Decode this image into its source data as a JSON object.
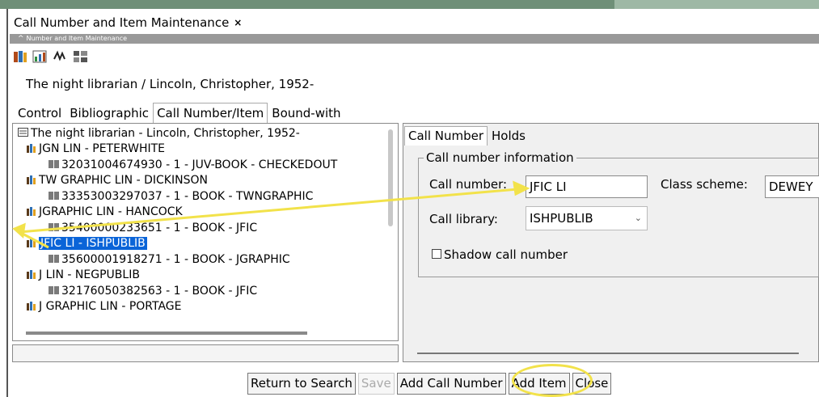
{
  "tab": {
    "title": "Call Number and Item Maintenance",
    "close": "×"
  },
  "window": {
    "subtitle": "Number and Item Maintenance"
  },
  "toolbar": {
    "icons": [
      "book-icon",
      "chart-icon",
      "sign-icon",
      "grid-icon"
    ]
  },
  "record": {
    "title_line": "The night librarian / Lincoln, Christopher, 1952-"
  },
  "main_tabs": [
    "Control",
    "Bibliographic",
    "Call Number/Item",
    "Bound-with"
  ],
  "tree": {
    "root": "The night librarian - Lincoln, Christopher, 1952-",
    "nodes": [
      "JGN LIN - PETERWHITE",
      "32031004674930 - 1 - JUV-BOOK - CHECKEDOUT",
      "TW GRAPHIC LIN - DICKINSON",
      "33353003297037 - 1 - BOOK - TWNGRAPHIC",
      "JGRAPHIC LIN - HANCOCK",
      "35400000233651 - 1 - BOOK - JFIC",
      "JFIC LI - ISHPUBLIB",
      "35600001918271 - 1 - BOOK - JGRAPHIC",
      "J  LIN - NEGPUBLIB",
      "32176050382563 - 1 - BOOK - JFIC",
      "J GRAPHIC LIN - PORTAGE"
    ]
  },
  "right_tabs": [
    "Call Number",
    "Holds"
  ],
  "callnum": {
    "legend": "Call number information",
    "call_number_label": "Call number:",
    "call_number_value": "JFIC LI",
    "class_scheme_label": "Class scheme:",
    "class_scheme_value": "DEWEY",
    "call_library_label": "Call library:",
    "call_library_value": "ISHPUBLIB",
    "shadow_label": "Shadow call number"
  },
  "buttons": {
    "return": "Return to Search",
    "save": "Save",
    "add_call": "Add Call Number",
    "add_item": "Add Item",
    "close": "Close"
  },
  "colors": {
    "selection": "#0a64d8",
    "annotation": "#f2e24a"
  }
}
